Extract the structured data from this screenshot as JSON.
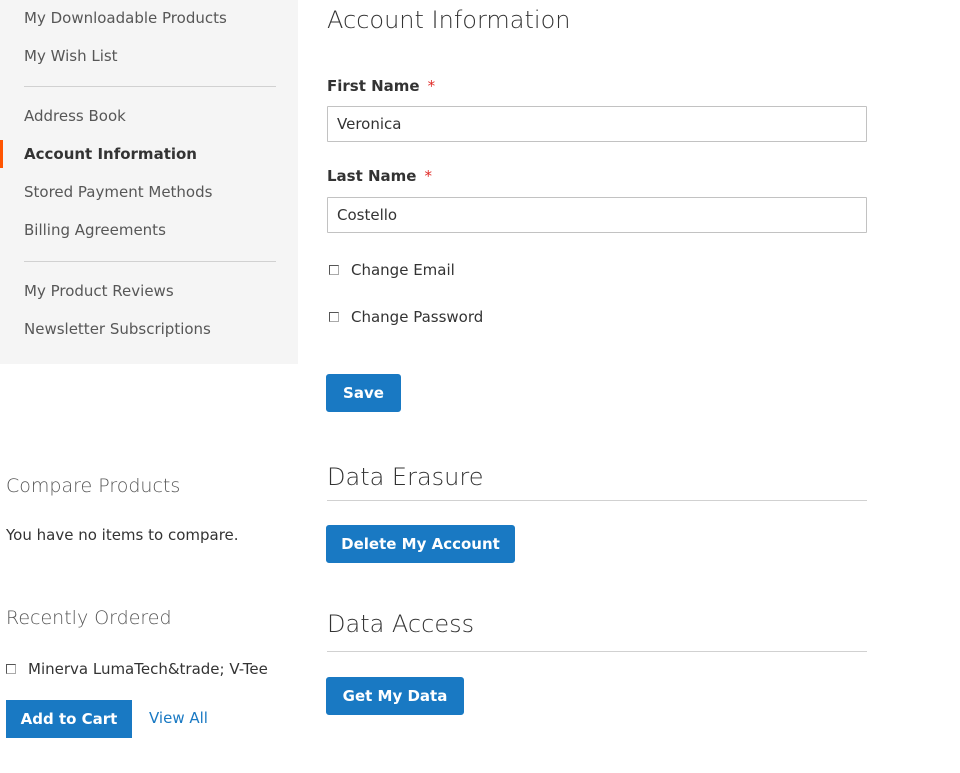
{
  "sidebar": {
    "items": [
      {
        "label": "My Downloadable Products"
      },
      {
        "label": "My Wish List"
      },
      {
        "label": "Address Book"
      },
      {
        "label": "Account Information"
      },
      {
        "label": "Stored Payment Methods"
      },
      {
        "label": "Billing Agreements"
      },
      {
        "label": "My Product Reviews"
      },
      {
        "label": "Newsletter Subscriptions"
      }
    ],
    "active_item": "Account Information"
  },
  "compare": {
    "title": "Compare Products",
    "empty_text": "You have no items to compare."
  },
  "recently_ordered": {
    "title": "Recently Ordered",
    "items": [
      {
        "name": "Minerva LumaTech&trade; V-Tee"
      }
    ],
    "add_to_cart_label": "Add to Cart",
    "view_all_label": "View All"
  },
  "account_info": {
    "title": "Account Information",
    "first_name": {
      "label": "First Name",
      "required_mark": "*",
      "value": "Veronica"
    },
    "last_name": {
      "label": "Last Name",
      "required_mark": "*",
      "value": "Costello"
    },
    "change_email_label": "Change Email",
    "change_password_label": "Change Password",
    "save_label": "Save"
  },
  "data_erasure": {
    "title": "Data Erasure",
    "button_label": "Delete My Account"
  },
  "data_access": {
    "title": "Data Access",
    "button_label": "Get My Data"
  },
  "colors": {
    "primary": "#1979c3",
    "active_marker": "#ff5501",
    "required": "#e02b27",
    "sidebar_bg": "#f5f5f5"
  }
}
